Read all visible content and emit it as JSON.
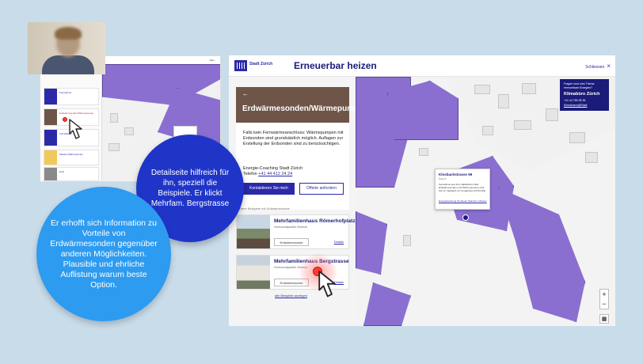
{
  "colors": {
    "accent": "#2a2aa8",
    "building": "#8a6fd1",
    "hatch": "#9aa7e6",
    "bubble_dark": "#1f35c8",
    "bubble_light": "#2d9bf0",
    "click": "#ff3b30"
  },
  "header": {
    "brand": "Stadt Zürich",
    "title": "Erneuerbar heizen",
    "close_label": "Schliessen",
    "close_icon": "close-icon"
  },
  "sidebar": {
    "back_icon": "arrow-left-icon",
    "heading": "Erdwärmesonden/Wärmepumpe",
    "description": "Falls kein Fernwärmeanschluss: Wärmepumpen mit Erdsonden sind grundsätzlich möglich. Auflagen zur Erstellung der Erdsonden sind zu berücksichtigen.",
    "coaching_label": "Energie-Coaching Stadt Zürich",
    "phone_prefix": "Telefon ",
    "phone": "+41 44 412 24 24",
    "contact_button": "Kontaktieren Sie mich",
    "offer_button": "Offerte anfordern",
    "examples_label": "Weitere Beispiele mit Erdwärmesonde",
    "examples": [
      {
        "title": "Mehrfamilienhaus Römerhofplatz",
        "subtitle": "Hochschulquartier Zentrum",
        "tag": "Erdwärmesonde",
        "details": "Details"
      },
      {
        "title": "Mehrfamilienhaus Bergstrasse",
        "subtitle": "Hochschulquartier Zentrum",
        "tag": "Erdwärmesonde",
        "details": "Details"
      }
    ],
    "all_examples": "alle Beispiele anzeigen"
  },
  "map": {
    "popup": {
      "title": "Klosbachstrasse 59",
      "subtitle": "Kreis 6",
      "text": "Fernwärme aus dem städtischen Netz. Erdwärmesonden und Wärmepumpen sind dort im Vergleich zur Umgebung mit Priorität.",
      "link": "Energieberatung für diesen Standort erfassen"
    },
    "klimabuero": {
      "question": "Fragen rund ums Thema erneuerbare Energien?",
      "name": "Klimabüro Zürich",
      "phone": "+41 44 789 35 35",
      "mail": "Klimabuero@Stadt"
    },
    "zoom_in": "+",
    "zoom_out": "−"
  },
  "thumb": {
    "toolbar": "Neu ›",
    "cards": [
      {
        "title": "Fernwärme",
        "color": "#2a2aa8"
      },
      {
        "title": "Erdwärmesonden/Wärmepumpe",
        "color": "#6e5547"
      },
      {
        "title": "Luft-Wasser",
        "color": "#2a2aa8"
      },
      {
        "title": "Wasser-Wärmepumpe",
        "color": "#f0c95a"
      },
      {
        "title": "Holz",
        "color": "#8a8a8a"
      }
    ]
  },
  "annotations": {
    "bubble_detail": "Detailseite hilfreich für ihn, speziell die Beispiele. Er klickt Mehrfam. Bergstrasse",
    "bubble_info": "Er erhofft sich Information zu Vorteile von Erdwärmesonden gegenüber anderen Möglichkeiten. Plausible und ehrliche Auflistung warum beste Option."
  }
}
